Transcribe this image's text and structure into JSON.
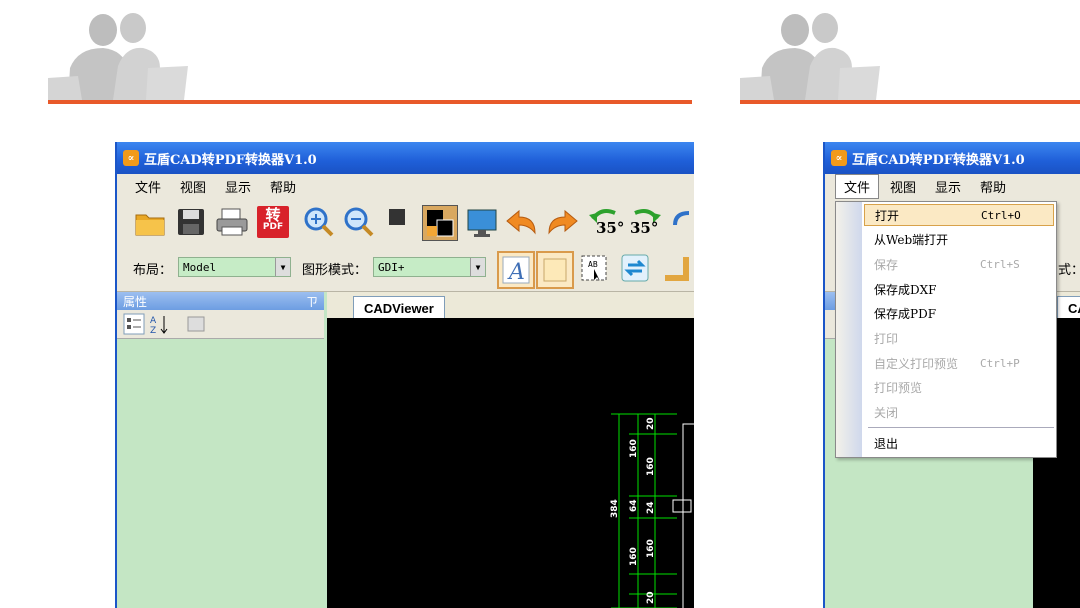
{
  "left_window": {
    "title": "互盾CAD转PDF转换器V1.0",
    "menu": [
      "文件",
      "视图",
      "显示",
      "帮助"
    ],
    "toolbar2": {
      "layout_label": "布局：",
      "layout_value": "Model",
      "mode_label": "图形模式：",
      "mode_value": "GDI+"
    },
    "pdf_button_top": "转",
    "pdf_button_bottom": "PDF",
    "rotate_left": "35°",
    "rotate_right": "35°",
    "properties_title": "属性",
    "pin_icon": "ㄗ",
    "tab": "CADViewer",
    "dimensions": {
      "left_total": "384",
      "left_a": "160",
      "left_b": "64",
      "left_c": "160",
      "right_a": "20",
      "right_b": "160",
      "right_c": "24",
      "right_d": "160",
      "right_e": "20"
    }
  },
  "right_window": {
    "title": "互盾CAD转PDF转换器V1.0",
    "menu": [
      "文件",
      "视图",
      "显示",
      "帮助"
    ],
    "partial_label": "式：",
    "partial_tab": "CA",
    "file_menu": [
      {
        "label": "打开",
        "shortcut": "Ctrl+O",
        "enabled": true,
        "selected": true
      },
      {
        "label": "从Web端打开",
        "shortcut": "",
        "enabled": true
      },
      {
        "label": "保存",
        "shortcut": "Ctrl+S",
        "enabled": false
      },
      {
        "label": "保存成DXF",
        "shortcut": "",
        "enabled": true
      },
      {
        "label": "保存成PDF",
        "shortcut": "",
        "enabled": true
      },
      {
        "label": "打印",
        "shortcut": "",
        "enabled": false
      },
      {
        "label": "自定义打印预览",
        "shortcut": "Ctrl+P",
        "enabled": false
      },
      {
        "label": "打印预览",
        "shortcut": "",
        "enabled": false
      },
      {
        "label": "关闭",
        "shortcut": "",
        "enabled": false
      },
      {
        "label": "退出",
        "shortcut": "",
        "enabled": true
      }
    ]
  },
  "colors": {
    "accent_line": "#e8592a",
    "title_bar": "#1f5fd8",
    "panel_green": "#c4e6c4",
    "dimension_green": "#00e000"
  }
}
